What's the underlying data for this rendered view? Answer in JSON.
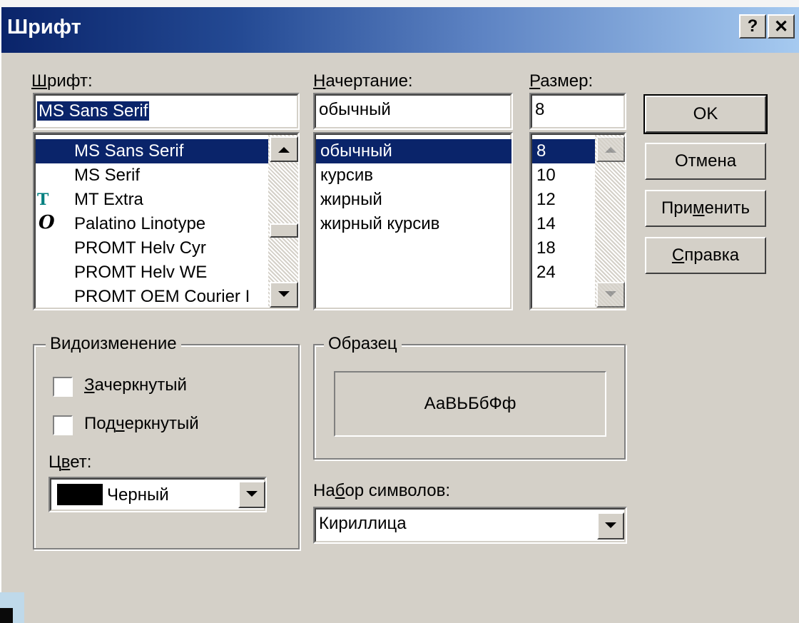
{
  "window": {
    "title": "Шрифт",
    "help_glyph": "?",
    "close_glyph": "✕"
  },
  "font": {
    "label_pre": "",
    "label_mn": "Ш",
    "label_post": "рифт:",
    "value": "MS Sans Serif",
    "items": [
      {
        "name": "MS Sans Serif",
        "icon": "",
        "selected": true
      },
      {
        "name": "MS Serif",
        "icon": "",
        "selected": false
      },
      {
        "name": "MT Extra",
        "icon": "truetype-icon",
        "selected": false
      },
      {
        "name": "Palatino Linotype",
        "icon": "opentype-icon",
        "selected": false
      },
      {
        "name": "PROMT Helv Cyr",
        "icon": "",
        "selected": false
      },
      {
        "name": "PROMT Helv WE",
        "icon": "",
        "selected": false
      },
      {
        "name": "PROMT OEM Courier I",
        "icon": "",
        "selected": false
      }
    ]
  },
  "style": {
    "label_pre": "",
    "label_mn": "Н",
    "label_post": "ачертание:",
    "value": "обычный",
    "items": [
      {
        "name": "обычный",
        "selected": true
      },
      {
        "name": "курсив",
        "selected": false
      },
      {
        "name": "жирный",
        "selected": false
      },
      {
        "name": "жирный курсив",
        "selected": false
      }
    ]
  },
  "size": {
    "label_pre": "",
    "label_mn": "Р",
    "label_post": "азмер:",
    "value": "8",
    "items": [
      {
        "name": "8",
        "selected": true
      },
      {
        "name": "10",
        "selected": false
      },
      {
        "name": "12",
        "selected": false
      },
      {
        "name": "14",
        "selected": false
      },
      {
        "name": "18",
        "selected": false
      },
      {
        "name": "24",
        "selected": false
      }
    ]
  },
  "buttons": {
    "ok": "OK",
    "cancel": "Отмена",
    "apply_pre": "При",
    "apply_mn": "м",
    "apply_post": "енить",
    "help_pre": "",
    "help_mn": "С",
    "help_post": "правка"
  },
  "effects": {
    "title": "Видоизменение",
    "strike_pre": "",
    "strike_mn": "З",
    "strike_post": "ачеркнутый",
    "strike_checked": false,
    "under_pre": "Под",
    "under_mn": "ч",
    "under_post": "еркнутый",
    "under_checked": false,
    "color_pre": "Ц",
    "color_mn": "в",
    "color_post": "ет:",
    "color_value": "Черный",
    "color_swatch": "#000000"
  },
  "sample": {
    "title": "Образец",
    "text": "АаВЬБбФф"
  },
  "charset": {
    "label_pre": "На",
    "label_mn": "б",
    "label_post": "ор символов:",
    "value": "Кириллица"
  },
  "colors": {
    "face": "#d4d0c8",
    "selection": "#0a246a",
    "title_start": "#0a246a",
    "title_end": "#a6caf0"
  }
}
